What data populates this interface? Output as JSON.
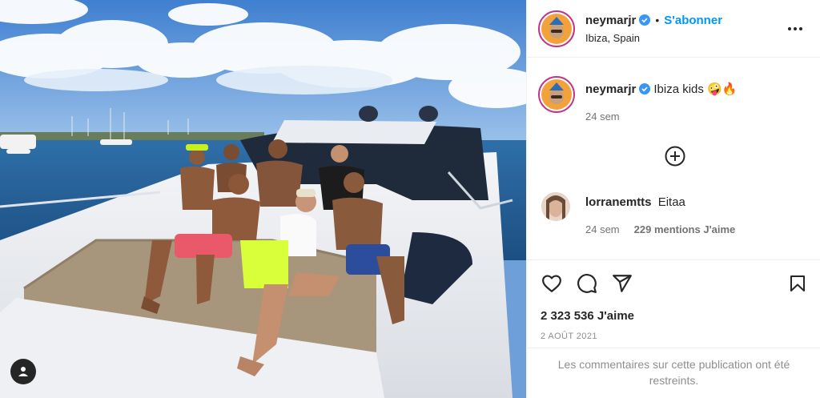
{
  "post": {
    "image_alt": "Group of friends sitting on the deck of a yacht in Ibiza",
    "user_tag_icon": "person-icon"
  },
  "header": {
    "username": "neymarjr",
    "verified_icon": "verified-badge-icon",
    "separator": "•",
    "follow_label": "S'abonner",
    "location": "Ibiza, Spain",
    "more_icon": "ellipsis-icon"
  },
  "caption": {
    "username": "neymarjr",
    "text": "Ibiza kids 🤪🔥",
    "time": "24 sem"
  },
  "load_more_icon": "plus-circle-icon",
  "comments": [
    {
      "username": "lorranemtts",
      "text": "Eitaa",
      "time": "24 sem",
      "likes": "229 mentions J'aime"
    }
  ],
  "actions": {
    "like_icon": "heart-icon",
    "comment_icon": "comment-icon",
    "share_icon": "paper-plane-icon",
    "save_icon": "bookmark-icon"
  },
  "likes_count": "2 323 536 J'aime",
  "date": "2 AOÛT 2021",
  "restricted_notice": "Les commentaires sur cette publication ont été restreints.",
  "colors": {
    "accent": "#0095f6",
    "text": "#262626",
    "muted": "#737373",
    "divider": "#efefef"
  }
}
